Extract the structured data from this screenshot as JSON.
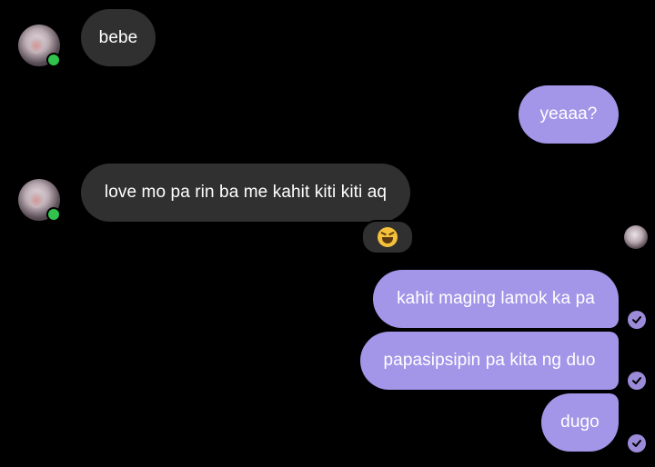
{
  "colors": {
    "background": "#000000",
    "incoming_bubble": "#303030",
    "outgoing_bubble": "#a395e8",
    "online_dot": "#31c24d",
    "delivered_check": "#9b8bd8"
  },
  "messages": [
    {
      "direction": "incoming",
      "text": "bebe"
    },
    {
      "direction": "outgoing",
      "text": "yeaaa?"
    },
    {
      "direction": "incoming",
      "text": "love mo pa rin ba me kahit kiti kiti aq",
      "reaction": "laughing-emoji"
    },
    {
      "direction": "outgoing",
      "text": "kahit maging lamok ka pa",
      "status": "delivered-check-icon"
    },
    {
      "direction": "outgoing",
      "text": "papasipsipin pa kita ng duo",
      "status": "delivered-check-icon"
    },
    {
      "direction": "outgoing",
      "text": "dugo",
      "status": "delivered-check-icon"
    }
  ]
}
